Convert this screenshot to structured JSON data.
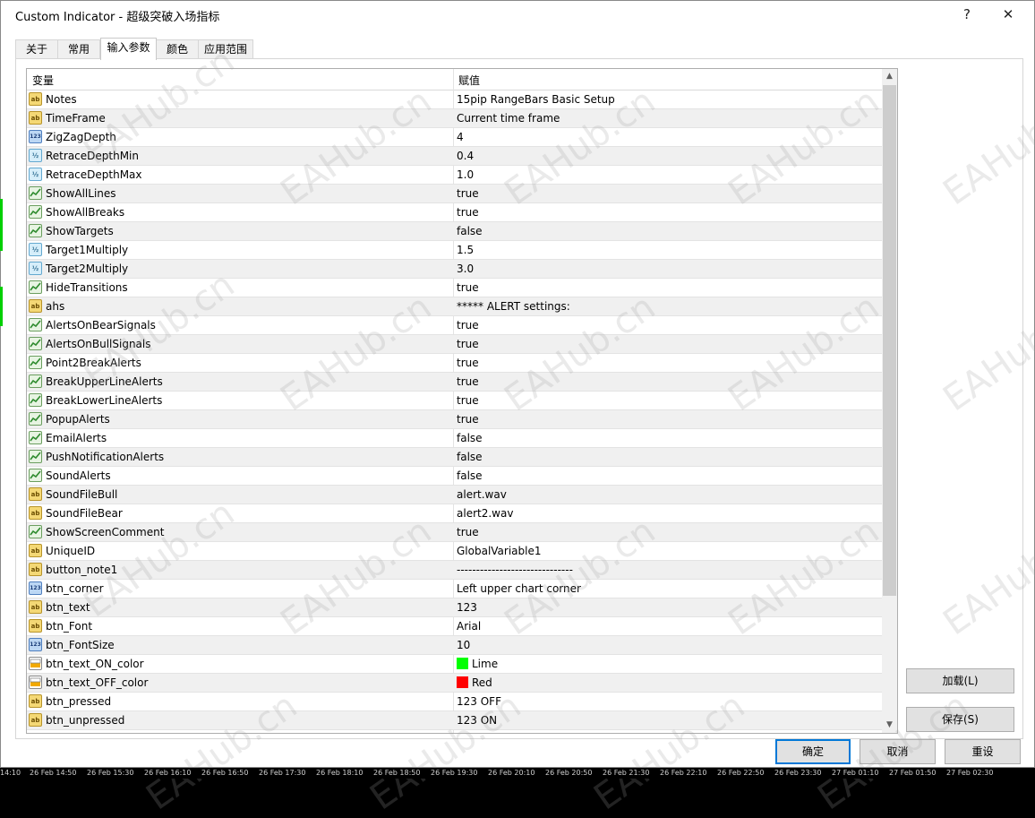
{
  "window": {
    "title": "Custom Indicator - 超级突破入场指标",
    "help_label": "?",
    "close_label": "✕"
  },
  "tabs": [
    {
      "label": "关于"
    },
    {
      "label": "常用"
    },
    {
      "label": "输入参数"
    },
    {
      "label": "颜色"
    },
    {
      "label": "应用范围"
    }
  ],
  "grid": {
    "header_variable": "变量",
    "header_value": "赋值",
    "rows": [
      {
        "icon": "ab",
        "name": "Notes",
        "value": "15pip RangeBars Basic Setup"
      },
      {
        "icon": "ab",
        "name": "TimeFrame",
        "value": "Current time frame"
      },
      {
        "icon": "123",
        "name": "ZigZagDepth",
        "value": "4"
      },
      {
        "icon": "½",
        "name": "RetraceDepthMin",
        "value": "0.4"
      },
      {
        "icon": "½",
        "name": "RetraceDepthMax",
        "value": "1.0"
      },
      {
        "icon": "bool",
        "name": "ShowAllLines",
        "value": "true"
      },
      {
        "icon": "bool",
        "name": "ShowAllBreaks",
        "value": "true"
      },
      {
        "icon": "bool",
        "name": "ShowTargets",
        "value": "false"
      },
      {
        "icon": "½",
        "name": "Target1Multiply",
        "value": "1.5"
      },
      {
        "icon": "½",
        "name": "Target2Multiply",
        "value": "3.0"
      },
      {
        "icon": "bool",
        "name": "HideTransitions",
        "value": "true"
      },
      {
        "icon": "ab",
        "name": "ahs",
        "value": "***** ALERT settings:"
      },
      {
        "icon": "bool",
        "name": "AlertsOnBearSignals",
        "value": "true"
      },
      {
        "icon": "bool",
        "name": "AlertsOnBullSignals",
        "value": "true"
      },
      {
        "icon": "bool",
        "name": "Point2BreakAlerts",
        "value": "true"
      },
      {
        "icon": "bool",
        "name": "BreakUpperLineAlerts",
        "value": "true"
      },
      {
        "icon": "bool",
        "name": "BreakLowerLineAlerts",
        "value": "true"
      },
      {
        "icon": "bool",
        "name": "PopupAlerts",
        "value": "true"
      },
      {
        "icon": "bool",
        "name": "EmailAlerts",
        "value": "false"
      },
      {
        "icon": "bool",
        "name": "PushNotificationAlerts",
        "value": "false"
      },
      {
        "icon": "bool",
        "name": "SoundAlerts",
        "value": "false"
      },
      {
        "icon": "ab",
        "name": "SoundFileBull",
        "value": "alert.wav"
      },
      {
        "icon": "ab",
        "name": "SoundFileBear",
        "value": "alert2.wav"
      },
      {
        "icon": "bool",
        "name": "ShowScreenComment",
        "value": "true"
      },
      {
        "icon": "ab",
        "name": "UniqueID",
        "value": "GlobalVariable1"
      },
      {
        "icon": "ab",
        "name": "button_note1",
        "value": "------------------------------"
      },
      {
        "icon": "123",
        "name": "btn_corner",
        "value": "Left upper chart corner"
      },
      {
        "icon": "ab",
        "name": "btn_text",
        "value": "123"
      },
      {
        "icon": "ab",
        "name": "btn_Font",
        "value": "Arial"
      },
      {
        "icon": "123",
        "name": "btn_FontSize",
        "value": "10"
      },
      {
        "icon": "color",
        "name": "btn_text_ON_color",
        "value": "Lime",
        "swatch": "#00ff00"
      },
      {
        "icon": "color",
        "name": "btn_text_OFF_color",
        "value": "Red",
        "swatch": "#ff0000"
      },
      {
        "icon": "ab",
        "name": "btn_pressed",
        "value": "123 OFF"
      },
      {
        "icon": "ab",
        "name": "btn_unpressed",
        "value": "123 ON"
      }
    ]
  },
  "buttons": {
    "load": "加载(L)",
    "save": "保存(S)",
    "ok": "确定",
    "cancel": "取消",
    "reset": "重设"
  },
  "watermark": "EAHub.cn",
  "time_axis": [
    "14:10",
    "26 Feb 14:50",
    "26 Feb 15:30",
    "26 Feb 16:10",
    "26 Feb 16:50",
    "26 Feb 17:30",
    "26 Feb 18:10",
    "26 Feb 18:50",
    "26 Feb 19:30",
    "26 Feb 20:10",
    "26 Feb 20:50",
    "26 Feb 21:30",
    "26 Feb 22:10",
    "26 Feb 22:50",
    "26 Feb 23:30",
    "27 Feb 01:10",
    "27 Feb 01:50",
    "27 Feb 02:30"
  ]
}
